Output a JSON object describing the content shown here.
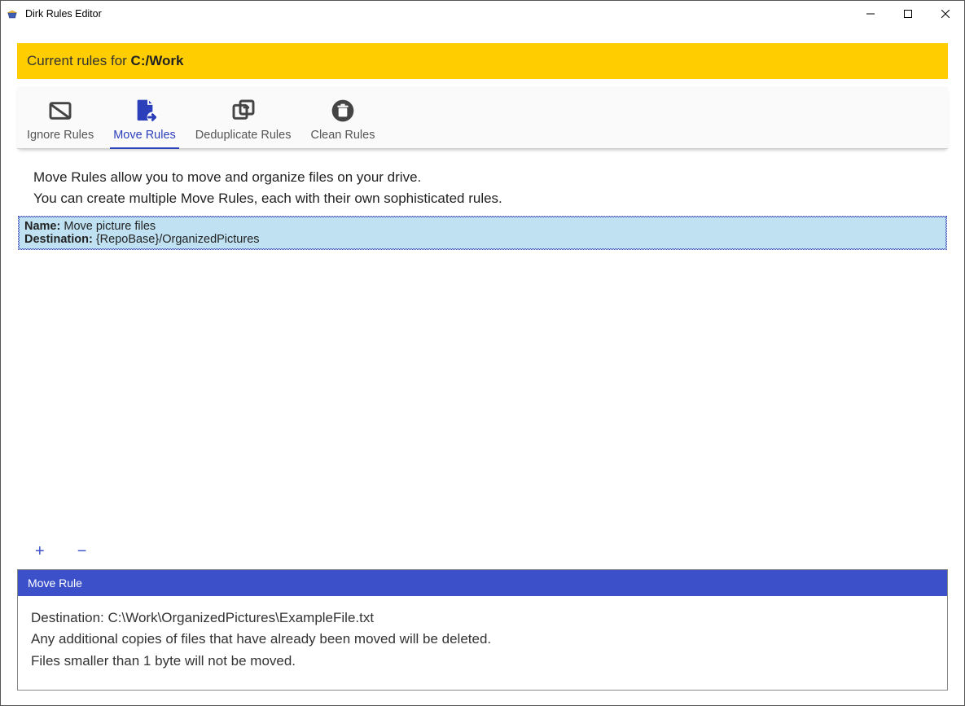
{
  "window": {
    "title": "Dirk Rules Editor"
  },
  "header": {
    "prefix": "Current rules for ",
    "path": "C:/Work"
  },
  "tabs": [
    {
      "label": "Ignore Rules",
      "icon": "ignore-icon",
      "active": false
    },
    {
      "label": "Move Rules",
      "icon": "move-icon",
      "active": true
    },
    {
      "label": "Deduplicate Rules",
      "icon": "deduplicate-icon",
      "active": false
    },
    {
      "label": "Clean Rules",
      "icon": "clean-icon",
      "active": false
    }
  ],
  "description": {
    "line1": "Move Rules allow you to move and organize files on your drive.",
    "line2": "You can create multiple Move Rules, each with their own sophisticated rules."
  },
  "rules": [
    {
      "name_label": "Name:",
      "name_value": "Move picture files",
      "dest_label": "Destination:",
      "dest_value": "{RepoBase}/OrganizedPictures"
    }
  ],
  "list_controls": {
    "add": "+",
    "remove": "−"
  },
  "detail": {
    "title": "Move Rule",
    "line1": "Destination: C:\\Work\\OrganizedPictures\\ExampleFile.txt",
    "line2": "Any additional copies of files that have already been moved will be deleted.",
    "line3": "Files smaller than 1 byte will not be moved."
  }
}
